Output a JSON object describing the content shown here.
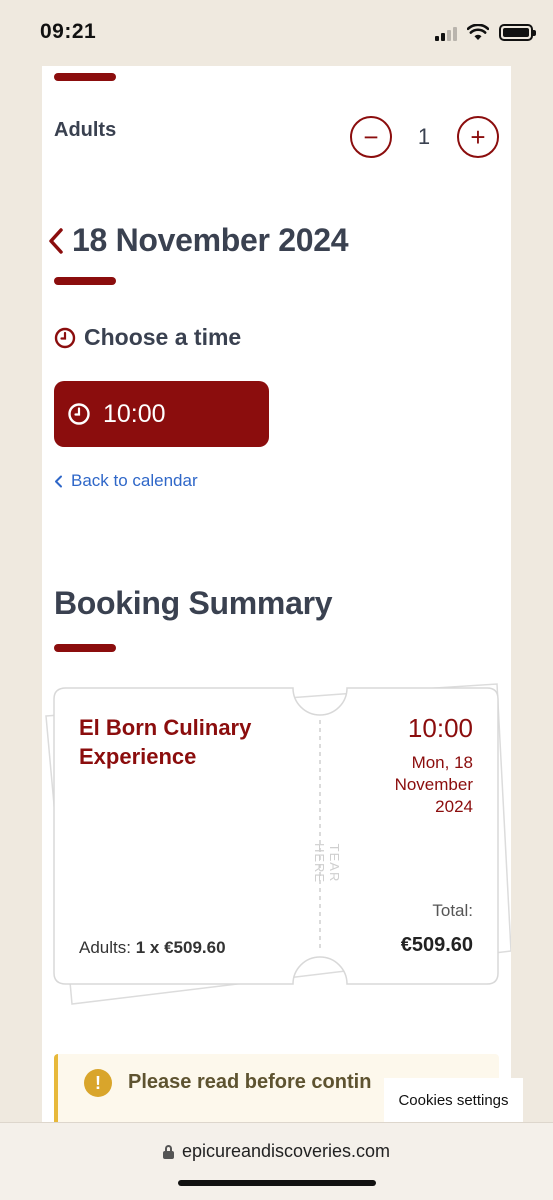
{
  "status_bar": {
    "time": "09:21"
  },
  "booking": {
    "adults_label": "Adults",
    "adults_count": "1",
    "minus_symbol": "−",
    "plus_symbol": "+",
    "date_title": "18 November 2024",
    "choose_time_label": "Choose a time",
    "time_slot": "10:00",
    "back_link": "Back to calendar"
  },
  "summary": {
    "title": "Booking Summary",
    "experience_name": "El Born Culinary Experience",
    "time": "10:00",
    "date": "Mon, 18 November 2024",
    "tear_label": "TEAR HERE",
    "total_label": "Total:",
    "total_value": "€509.60",
    "adults_prefix": "Adults:",
    "adults_detail": "1 x €509.60"
  },
  "notice": {
    "text": "Please read before contin"
  },
  "cookies": {
    "label": "Cookies settings"
  },
  "browser": {
    "url": "epicureandiscoveries.com"
  },
  "colors": {
    "accent": "#8b0d0d",
    "link": "#2f67c8",
    "notice_border": "#e7b83a"
  }
}
